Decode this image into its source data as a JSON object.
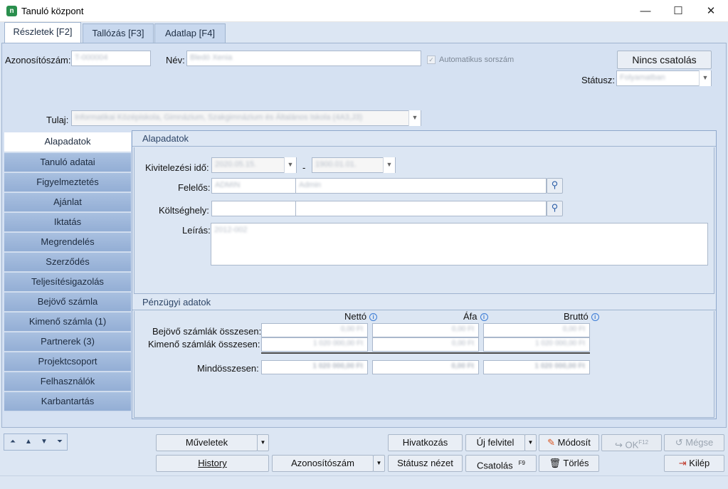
{
  "window": {
    "title": "Tanuló központ",
    "minimize": "—",
    "maximize": "☐",
    "close": "✕"
  },
  "tabs": [
    {
      "label": "Részletek [F2]"
    },
    {
      "label": "Tallózás [F3]"
    },
    {
      "label": "Adatlap [F4]"
    }
  ],
  "header": {
    "id_label": "Azonosítószám:",
    "id_value": "T-000004",
    "name_label": "Név:",
    "name_value": "Bledó Xenia",
    "auto_label": "Automatikus sorszám",
    "attach_label": "Nincs csatolás",
    "status_label": "Státusz:",
    "status_value": "Folyamatban",
    "owner_label": "Tulaj:",
    "owner_value": "Informatikai Középiskola, Gimnázium, Szakgimnázium és Általános Iskola (4A3,J3)"
  },
  "sidenav": [
    {
      "label": "Alapadatok"
    },
    {
      "label": "Tanuló adatai"
    },
    {
      "label": "Figyelmeztetés"
    },
    {
      "label": "Ajánlat"
    },
    {
      "label": "Iktatás"
    },
    {
      "label": "Megrendelés"
    },
    {
      "label": "Szerződés"
    },
    {
      "label": "Teljesítésigazolás"
    },
    {
      "label": "Bejövő számla"
    },
    {
      "label": "Kimenő számla (1)"
    },
    {
      "label": "Partnerek (3)"
    },
    {
      "label": "Projektcsoport"
    },
    {
      "label": "Felhasználók"
    },
    {
      "label": "Karbantartás"
    }
  ],
  "basic": {
    "title": "Alapadatok",
    "period_label": "Kivitelezési idő:",
    "period_from": "2020.05.15.",
    "period_sep": "-",
    "period_to": "1900.01.01.",
    "resp_label": "Felelős:",
    "resp_code": "ADMIN",
    "resp_name": "Admin",
    "cost_label": "Költséghely:",
    "cost_code": "",
    "cost_name": "",
    "desc_label": "Leírás:",
    "desc_value": "2012-002"
  },
  "finance": {
    "title": "Pénzügyi adatok",
    "col_net": "Nettó",
    "col_vat": "Áfa",
    "col_gross": "Bruttó",
    "row_in": "Bejövő számlák összesen:",
    "row_out": "Kimenő számlák összesen:",
    "row_total": "Mindösszesen:",
    "in_net": "0,00 Ft",
    "in_vat": "0,00 Ft",
    "in_gross": "0,00 Ft",
    "out_net": "1 020 000,00 Ft",
    "out_vat": "0,00 Ft",
    "out_gross": "1 020 000,00 Ft",
    "total_net": "1 020 000,00 Ft",
    "total_vat": "0,00 Ft",
    "total_gross": "1 020 000,00 Ft"
  },
  "footer": {
    "actions": "Műveletek",
    "history": "History",
    "reference": "Hivatkozás",
    "new": "Új felvitel",
    "modify": "Módosít",
    "ok": "OK",
    "ok_key": "F12",
    "cancel": "Mégse",
    "idnum": "Azonosítószám",
    "status_view": "Státusz nézet",
    "attach": "Csatolás",
    "attach_key": "F9",
    "delete": "Törlés",
    "exit": "Kilép"
  }
}
